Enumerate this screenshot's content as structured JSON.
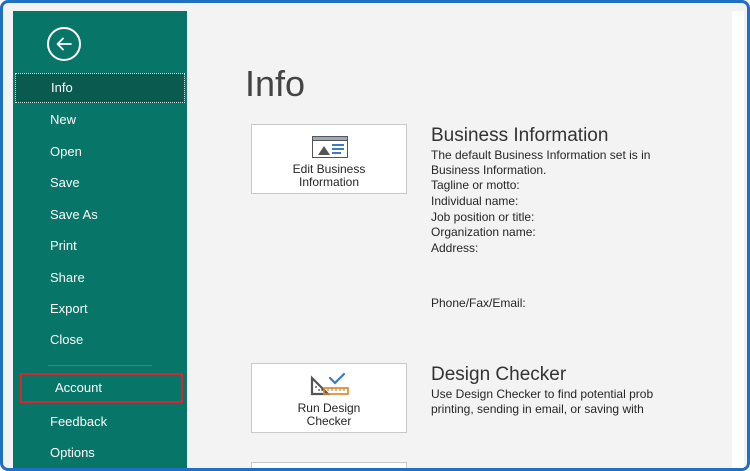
{
  "sidebar": {
    "items": [
      {
        "label": "Info"
      },
      {
        "label": "New"
      },
      {
        "label": "Open"
      },
      {
        "label": "Save"
      },
      {
        "label": "Save As"
      },
      {
        "label": "Print"
      },
      {
        "label": "Share"
      },
      {
        "label": "Export"
      },
      {
        "label": "Close"
      },
      {
        "label": "Account"
      },
      {
        "label": "Feedback"
      },
      {
        "label": "Options"
      }
    ],
    "back_icon": "back-arrow-icon"
  },
  "main": {
    "title": "Info",
    "business": {
      "button_line1": "Edit Business",
      "button_line2": "Information",
      "title": "Business Information",
      "desc_line1": "The default Business Information set is in",
      "desc_line2": "Business Information.",
      "fields": [
        {
          "label": "Tagline or motto:"
        },
        {
          "label": "Individual name:"
        },
        {
          "label": "Job position or title:"
        },
        {
          "label": "Organization name:"
        },
        {
          "label": "Address:"
        },
        {
          "label": "Phone/Fax/Email:"
        }
      ]
    },
    "design": {
      "button_line1": "Run Design",
      "button_line2": "Checker",
      "title": "Design Checker",
      "desc_line1": "Use Design Checker to find potential prob",
      "desc_line2": "printing, sending in email, or saving with"
    }
  },
  "colors": {
    "sidebar": "#077568",
    "highlight": "#d9262e",
    "frame": "#1f6fc5"
  }
}
